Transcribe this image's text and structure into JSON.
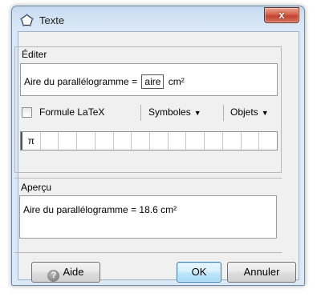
{
  "window": {
    "title": "Texte",
    "close_label": "x",
    "icon": "pentagon-outline-icon"
  },
  "edit_panel": {
    "label": "Éditer",
    "text_before": "Aire du parallélogramme =",
    "field_value": "aire",
    "text_after": "cm²",
    "latex_checkbox_label": "Formule LaTeX",
    "latex_checked": false,
    "symbols_label": "Symboles",
    "objects_label": "Objets",
    "symbol_cells": [
      "π",
      "",
      "",
      "",
      "",
      "",
      "",
      "",
      "",
      "",
      "",
      "",
      "",
      ""
    ]
  },
  "preview_panel": {
    "label": "Aperçu",
    "text": "Aire du parallélogramme =  18.6 cm²"
  },
  "buttons": {
    "help_label": "Aide",
    "help_icon": "?",
    "ok_label": "OK",
    "cancel_label": "Annuler"
  }
}
